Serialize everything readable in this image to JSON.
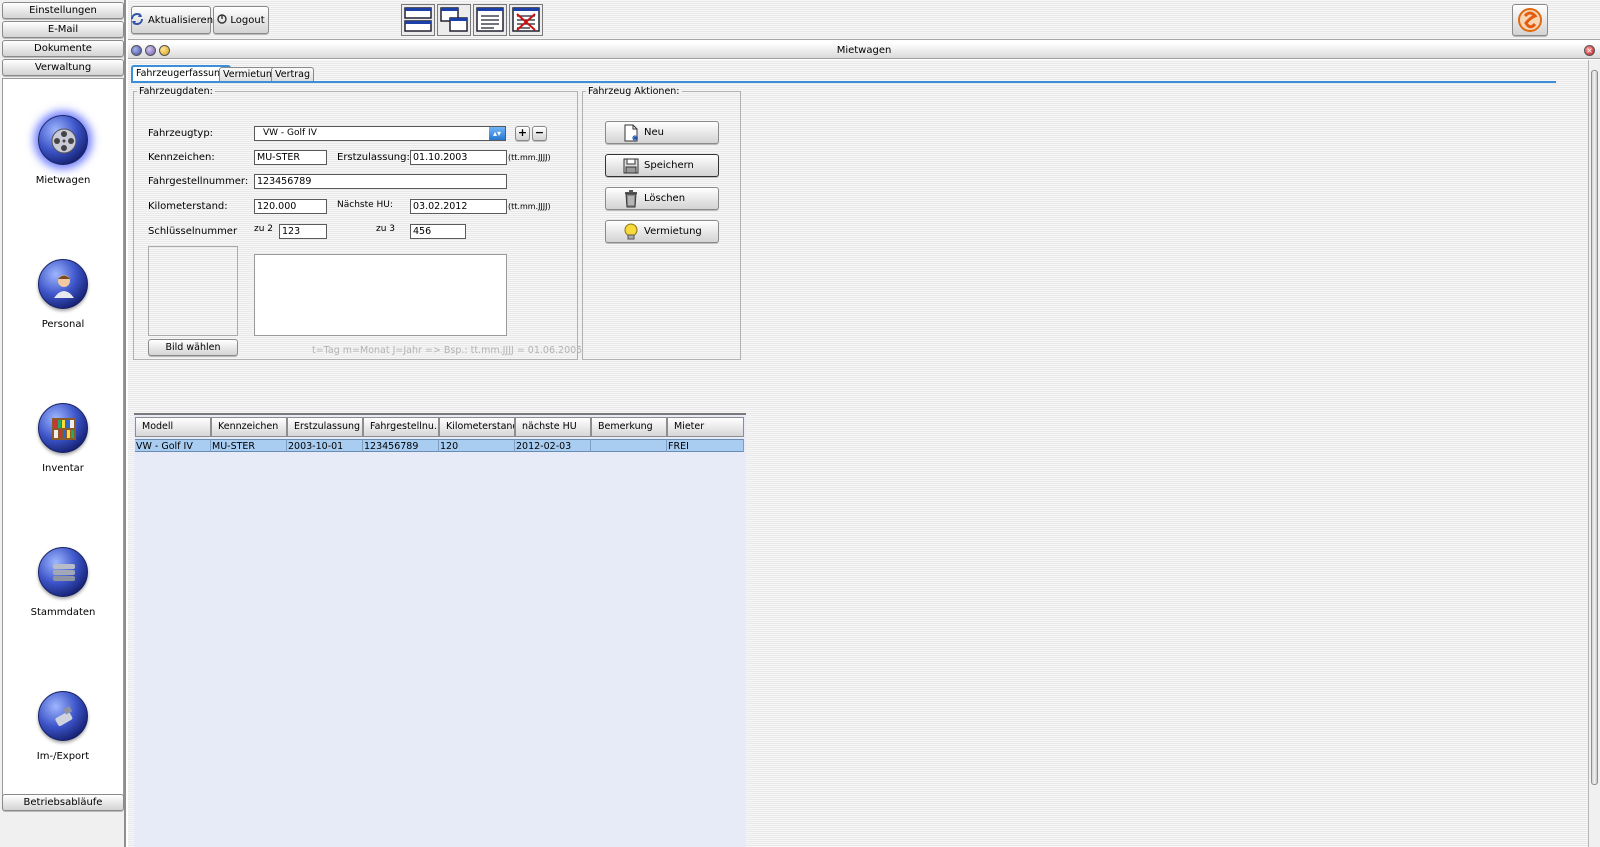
{
  "sidebar": {
    "top_buttons": [
      "Einstellungen",
      "E-Mail",
      "Dokumente",
      "Verwaltung"
    ],
    "nav": [
      {
        "label": "Mietwagen",
        "icon": "film-reel-icon",
        "active": true
      },
      {
        "label": "Personal",
        "icon": "person-icon",
        "active": false
      },
      {
        "label": "Inventar",
        "icon": "bookshelf-icon",
        "active": false
      },
      {
        "label": "Stammdaten",
        "icon": "database-stack-icon",
        "active": false
      },
      {
        "label": "Im-/Export",
        "icon": "usb-plug-icon",
        "active": false
      }
    ],
    "bottom_button": "Betriebsabläufe"
  },
  "toolbar": {
    "refresh_label": "Aktualisieren",
    "logout_label": "Logout",
    "window_icons": [
      "tile-horizontal-icon",
      "cascade-icon",
      "document-icon",
      "close-all-icon"
    ],
    "app_icon": "app-logo-icon"
  },
  "window": {
    "title": "Mietwagen"
  },
  "tabs": [
    {
      "label": "Fahrzeugerfassung",
      "active": true
    },
    {
      "label": "Vermietung",
      "active": false
    },
    {
      "label": "Vertrag",
      "active": false
    }
  ],
  "vehicle_form": {
    "legend": "Fahrzeugdaten:",
    "type_label": "Fahrzeugtyp:",
    "type_value": "VW - Golf IV",
    "plate_label": "Kennzeichen:",
    "plate_value": "MU-STER",
    "registration_label": "Erstzulassung:",
    "registration_value": "01.10.2003",
    "date_hint": "(tt.mm.JJJJ)",
    "vin_label": "Fahrgestellnummer:",
    "vin_value": "123456789",
    "mileage_label": "Kilometerstand:",
    "mileage_value": "120.000",
    "next_hu_label": "Nächste HU:",
    "next_hu_value": "03.02.2012",
    "key_label": "Schlüsselnummer",
    "key2_label": "zu 2",
    "key2_value": "123",
    "key3_label": "zu 3",
    "key3_value": "456",
    "choose_image_label": "Bild wählen",
    "date_format_note": "t=Tag m=Monat J=Jahr => Bsp.: tt.mm.JJJJ = 01.06.2005",
    "add_label": "+",
    "remove_label": "−"
  },
  "actions": {
    "legend": "Fahrzeug Aktionen:",
    "buttons": [
      {
        "label": "Neu",
        "icon": "new-document-icon"
      },
      {
        "label": "Speichern",
        "icon": "floppy-disk-icon"
      },
      {
        "label": "Löschen",
        "icon": "trash-icon"
      },
      {
        "label": "Vermietung",
        "icon": "lightbulb-icon"
      }
    ]
  },
  "table": {
    "columns": [
      "Modell",
      "Kennzeichen",
      "Erstzulassung",
      "Fahrgestellnu...",
      "Kilometerstand",
      "nächste HU",
      "Bemerkung",
      "Mieter"
    ],
    "rows": [
      [
        "VW - Golf IV",
        "MU-STER",
        "2003-10-01",
        "123456789",
        "120",
        "2012-02-03",
        "",
        "FREI"
      ]
    ]
  }
}
